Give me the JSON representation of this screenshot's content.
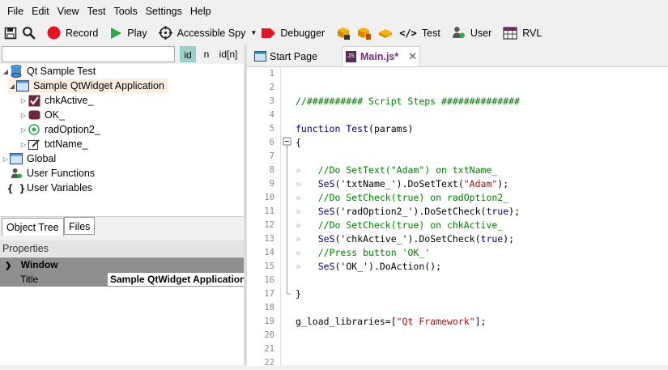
{
  "menu": [
    "File",
    "Edit",
    "View",
    "Test",
    "Tools",
    "Settings",
    "Help"
  ],
  "toolbar": {
    "record": "Record",
    "play": "Play",
    "accessible_spy": "Accessible Spy",
    "debugger": "Debugger",
    "test": "Test",
    "user": "User",
    "rvl": "RVL"
  },
  "search": {
    "value": "",
    "placeholder": ""
  },
  "id_buttons": [
    "id",
    "n",
    "id[n]"
  ],
  "tree": {
    "root": "Qt Sample Test",
    "app": "Sample QtWidget Application",
    "children": [
      "chkActive_",
      "OK_",
      "radOption2_",
      "txtName_"
    ],
    "global": "Global",
    "user_functions": "User Functions",
    "user_variables": "User Variables"
  },
  "left_tabs": [
    "Object Tree",
    "Files"
  ],
  "properties": {
    "title": "Properties",
    "group": "Window",
    "row_key": "Title",
    "row_value": "Sample QtWidget Application"
  },
  "editor_tabs": [
    {
      "label": "Start Page"
    },
    {
      "label": "Main.js*"
    }
  ],
  "line_numbers": [
    "1",
    "2",
    "3",
    "4",
    "5",
    "6",
    "7",
    "8",
    "9",
    "10",
    "11",
    "12",
    "13",
    "14",
    "15",
    "16",
    "17",
    "18",
    "19",
    "20",
    "21",
    "22"
  ],
  "code": {
    "l3": "//########## Script Steps ##############",
    "l5_kw": "function",
    "l5_name": "Test",
    "l5_rest": "(params)",
    "l6": "{",
    "l8": "//Do SetText(\"Adam\") on txtName_",
    "l9_a": "SeS",
    "l9_b": "('txtName_').DoSetText(",
    "l9_c": "\"Adam\"",
    "l9_d": ");",
    "l10": "//Do SetCheck(true) on radOption2_",
    "l11_a": "SeS",
    "l11_b": "('radOption2_').DoSetCheck(",
    "l11_c": "true",
    "l11_d": ");",
    "l12": "//Do SetCheck(true) on chkActive_",
    "l13_a": "SeS",
    "l13_b": "('chkActive_').DoSetCheck(",
    "l13_c": "true",
    "l13_d": ");",
    "l14": "//Press button 'OK_'",
    "l15_a": "SeS",
    "l15_b": "('OK_').DoAction();",
    "l17": "}",
    "l19_a": "g_load_libraries=[",
    "l19_b": "\"Qt Framework\"",
    "l19_c": "];",
    "indent_marker": "»"
  },
  "colors": {
    "accent": "#7b2a7d",
    "record": "#e81123",
    "play": "#2aa84a",
    "debugger": "#e81123"
  }
}
